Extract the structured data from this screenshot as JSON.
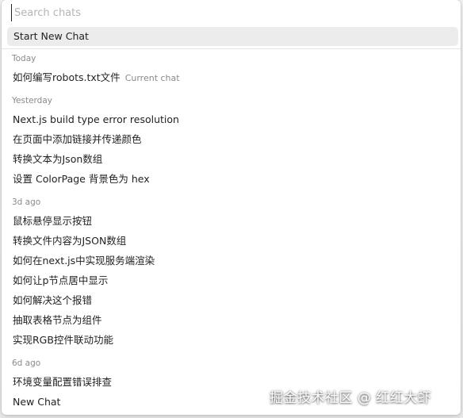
{
  "search": {
    "placeholder": "Search chats"
  },
  "new_chat_label": "Start New Chat",
  "groups": {
    "today": {
      "label": "Today",
      "items": [
        {
          "title": "如何编写robots.txt文件",
          "tag": "Current chat"
        }
      ]
    },
    "yesterday": {
      "label": "Yesterday",
      "items": [
        {
          "title": "Next.js build type error resolution"
        },
        {
          "title": "在页面中添加链接并传递颜色"
        },
        {
          "title": "转换文本为Json数组"
        },
        {
          "title": "设置 ColorPage 背景色为 hex"
        }
      ]
    },
    "three_days": {
      "label": "3d ago",
      "items": [
        {
          "title": "鼠标悬停显示按钮"
        },
        {
          "title": "转换文件内容为JSON数组"
        },
        {
          "title": "如何在next.js中实现服务端渲染"
        },
        {
          "title": "如何让p节点居中显示"
        },
        {
          "title": "如何解决这个报错"
        },
        {
          "title": "抽取表格节点为组件"
        },
        {
          "title": "实现RGB控件联动功能"
        }
      ]
    },
    "six_days": {
      "label": "6d ago",
      "items": [
        {
          "title": "环境变量配置错误排查"
        },
        {
          "title": "New Chat"
        }
      ]
    }
  },
  "watermark": "掘金技术社区 @ 红红大虾"
}
